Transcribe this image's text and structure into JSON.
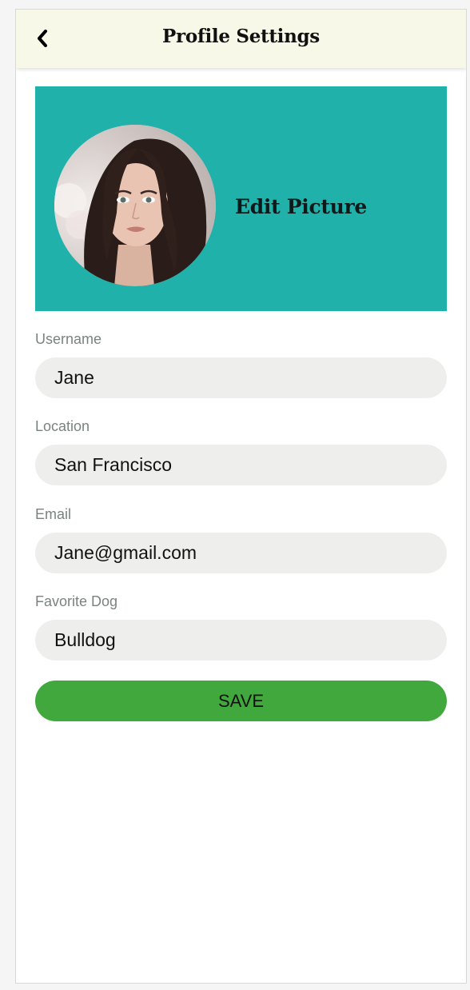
{
  "header": {
    "title": "Profile Settings",
    "back_icon": "chevron-left-icon"
  },
  "profile": {
    "edit_picture_label": "Edit Picture",
    "banner_color": "#20b1ab"
  },
  "form": {
    "fields": [
      {
        "label": "Username",
        "value": "Jane"
      },
      {
        "label": "Location",
        "value": "San Francisco"
      },
      {
        "label": "Email",
        "value": "Jane@gmail.com"
      },
      {
        "label": "Favorite Dog",
        "value": "Bulldog"
      }
    ],
    "save_label": "SAVE",
    "save_color": "#41a83e"
  }
}
